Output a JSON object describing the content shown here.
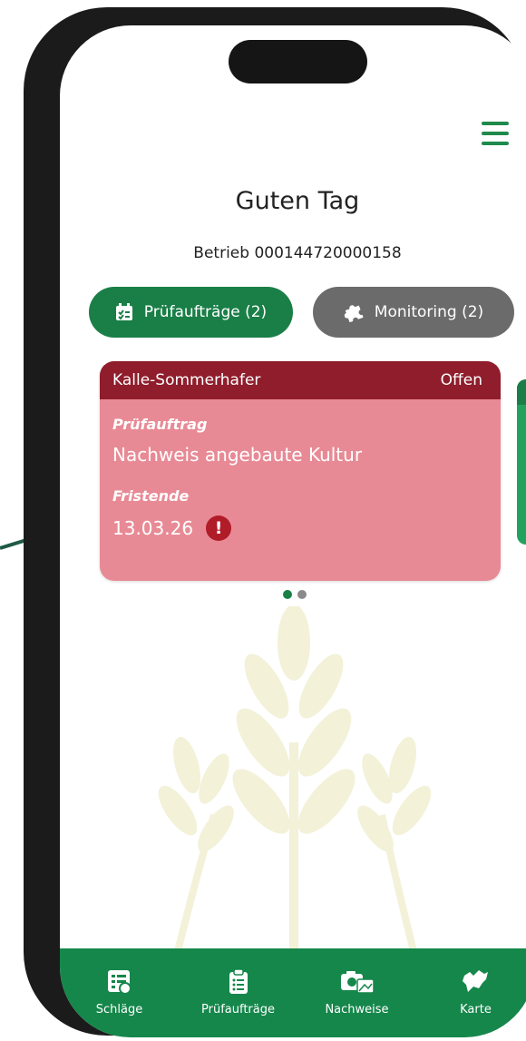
{
  "header": {
    "greeting": "Guten Tag",
    "betrieb": "Betrieb 000144720000158"
  },
  "tabs": [
    {
      "label": "Prüfaufträge (2)",
      "icon": "checklist-icon",
      "active": true
    },
    {
      "label": "Monitoring (2)",
      "icon": "puzzle-icon",
      "active": false
    }
  ],
  "card": {
    "field_name": "Kalle-Sommerhafer",
    "status": "Offen",
    "type_label": "Prüfauftrag",
    "type_value": "Nachweis angebaute Kultur",
    "deadline_label": "Fristende",
    "deadline_value": "13.03.26",
    "warning_symbol": "!"
  },
  "pagination": {
    "pages": 2,
    "current": 1
  },
  "bottom_nav": [
    {
      "label": "Schläge",
      "icon": "fields-list-icon"
    },
    {
      "label": "Prüfaufträge",
      "icon": "clipboard-icon"
    },
    {
      "label": "Nachweise",
      "icon": "camera-photo-icon"
    },
    {
      "label": "Karte",
      "icon": "map-region-icon"
    }
  ],
  "colors": {
    "primary_green": "#1a7f47",
    "nav_green": "#15874b",
    "card_bg": "#e88a95",
    "card_header": "#8f1d2c",
    "warning_red": "#b01c28",
    "inactive_gray": "#6b6b6b"
  }
}
